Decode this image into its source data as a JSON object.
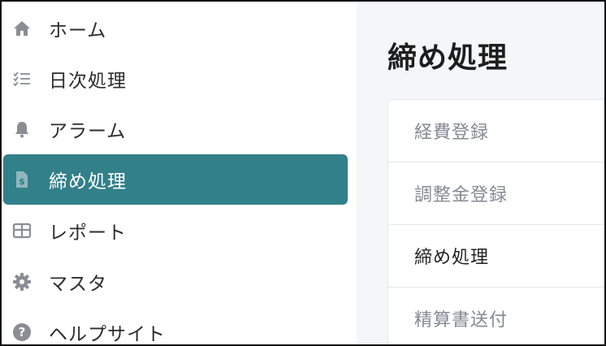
{
  "sidebar": {
    "items": [
      {
        "label": "ホーム",
        "icon": "home-icon"
      },
      {
        "label": "日次処理",
        "icon": "checklist-icon"
      },
      {
        "label": "アラーム",
        "icon": "bell-icon"
      },
      {
        "label": "締め処理",
        "icon": "invoice-icon",
        "active": true
      },
      {
        "label": "レポート",
        "icon": "table-icon"
      },
      {
        "label": "マスタ",
        "icon": "gear-icon"
      },
      {
        "label": "ヘルプサイト",
        "icon": "help-icon"
      }
    ]
  },
  "main": {
    "title": "締め処理",
    "submenu": [
      {
        "label": "経費登録"
      },
      {
        "label": "調整金登録"
      },
      {
        "label": "締め処理",
        "active": true
      },
      {
        "label": "精算書送付"
      }
    ]
  },
  "colors": {
    "active_bg": "#32808a",
    "main_bg": "#f5f6f8",
    "icon": "#8a8d93"
  }
}
